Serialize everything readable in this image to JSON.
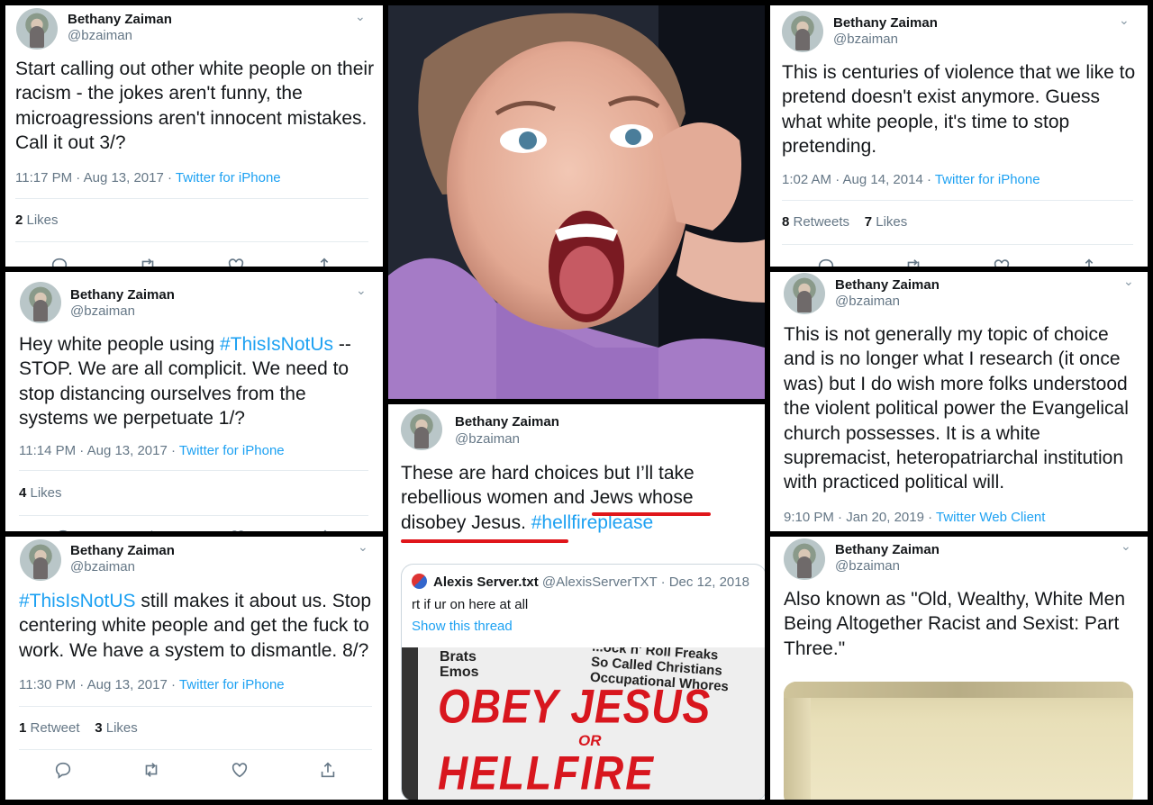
{
  "author": {
    "name": "Bethany Zaiman",
    "handle": "@bzaiman"
  },
  "tweets": {
    "t1": {
      "text": "Start calling out other white people on their racism - the jokes aren't funny, the microagressions aren't innocent mistakes. Call it out 3/?",
      "time": "11:17 PM · Aug 13, 2017 · ",
      "source": "Twitter for iPhone",
      "likes_n": "2",
      "likes_l": " Likes"
    },
    "t2": {
      "text_pre": "Hey white people using ",
      "hashtag": "#ThisIsNotUs",
      "text_post": " -- STOP. We are all complicit. We need to stop distancing ourselves from the systems we perpetuate 1/?",
      "time": "11:14 PM · Aug 13, 2017 · ",
      "source": "Twitter for iPhone",
      "likes_n": "4",
      "likes_l": " Likes"
    },
    "t3": {
      "hashtag": "#ThisIsNotUS",
      "text_post": " still makes it about us. Stop centering white people and get the fuck to work. We have a system to dismantle. 8/?",
      "time": "11:30 PM · Aug 13, 2017 · ",
      "source": "Twitter for iPhone",
      "rt_n": "1",
      "rt_l": " Retweet",
      "likes_n": "3",
      "likes_l": " Likes"
    },
    "t4": {
      "text_pre": "These are hard choices but I’ll take rebellious women and Jews whose disobey Jesus. ",
      "hashtag": "#hellfireplease"
    },
    "quote": {
      "name": "Alexis Server.txt",
      "meta": " @AlexisServerTXT · Dec 12, 2018",
      "text": "rt if ur on here at all",
      "link": "Show this thread"
    },
    "sign": {
      "line1a": "Brats",
      "line1b": "Emos",
      "line2": "...ock n' Roll Freaks",
      "line3": "So Called Christians",
      "line4": "Occupational Whores",
      "big1": "OBEY JESUS",
      "or": "OR",
      "big2": "HELLFIRE"
    },
    "t5": {
      "text": "This is centuries of violence that we like to pretend doesn't exist anymore. Guess what white people, it's time to stop pretending.",
      "time": "1:02 AM · Aug 14, 2014 · ",
      "source": "Twitter for iPhone",
      "rt_n": "8",
      "rt_l": " Retweets",
      "likes_n": "7",
      "likes_l": " Likes"
    },
    "t6": {
      "text": "This is not generally my topic of choice and is no longer what I research (it once was) but I do wish more folks understood the violent political power the Evangelical church possesses. It is a white supremacist, heteropatriarchal institution with practiced political will.",
      "time": "9:10 PM · Jan 20, 2019 · ",
      "source": "Twitter Web Client"
    },
    "t7": {
      "text": "Also known as \"Old, Wealthy, White Men Being Altogether Racist and Sexist: Part Three.\""
    }
  },
  "icons": [
    "chevron-down-icon",
    "reply-icon",
    "retweet-icon",
    "like-icon",
    "share-icon"
  ],
  "colors": {
    "link": "#1da1f2",
    "text": "#14171a",
    "muted": "#657786",
    "underline": "#e0161b"
  }
}
